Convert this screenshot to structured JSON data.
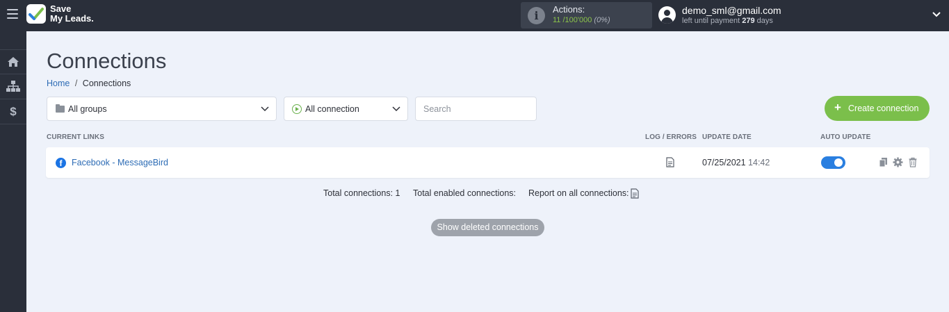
{
  "brand": {
    "line1": "Save",
    "line2": "My Leads."
  },
  "actions": {
    "label": "Actions:",
    "used": "11 /100'000",
    "percent": "(0%)"
  },
  "user": {
    "email": "demo_sml@gmail.com",
    "days_prefix": "left until payment",
    "days": "279",
    "days_suffix": "days"
  },
  "sidebar": {
    "items": [
      {
        "icon": "home-icon"
      },
      {
        "icon": "sitemap-icon"
      },
      {
        "icon": "dollar-icon",
        "glyph": "$"
      }
    ]
  },
  "page": {
    "title": "Connections"
  },
  "breadcrumb": {
    "home": "Home",
    "separator": "/",
    "current": "Connections"
  },
  "filters": {
    "group_select": "All groups",
    "connection_select": "All connection",
    "search_placeholder": "Search"
  },
  "create_button": {
    "plus": "+",
    "label": "Create connection"
  },
  "columns": {
    "current_links": "CURRENT LINKS",
    "log_errors": "LOG / ERRORS",
    "update_date": "UPDATE DATE",
    "auto_update": "AUTO UPDATE"
  },
  "connections": [
    {
      "name": "Facebook - MessageBird",
      "icon": "facebook-icon",
      "date": "07/25/2021",
      "time": "14:42",
      "auto_update": true
    }
  ],
  "totals": {
    "total": "Total connections: 1",
    "enabled": "Total enabled connections:",
    "report": "Report on all connections:"
  },
  "show_deleted": "Show deleted connections",
  "colors": {
    "topbar": "#2a2f3a",
    "accent_green": "#7bbf4b",
    "link_blue": "#2d6cb5",
    "toggle_blue": "#2a7fe0"
  }
}
